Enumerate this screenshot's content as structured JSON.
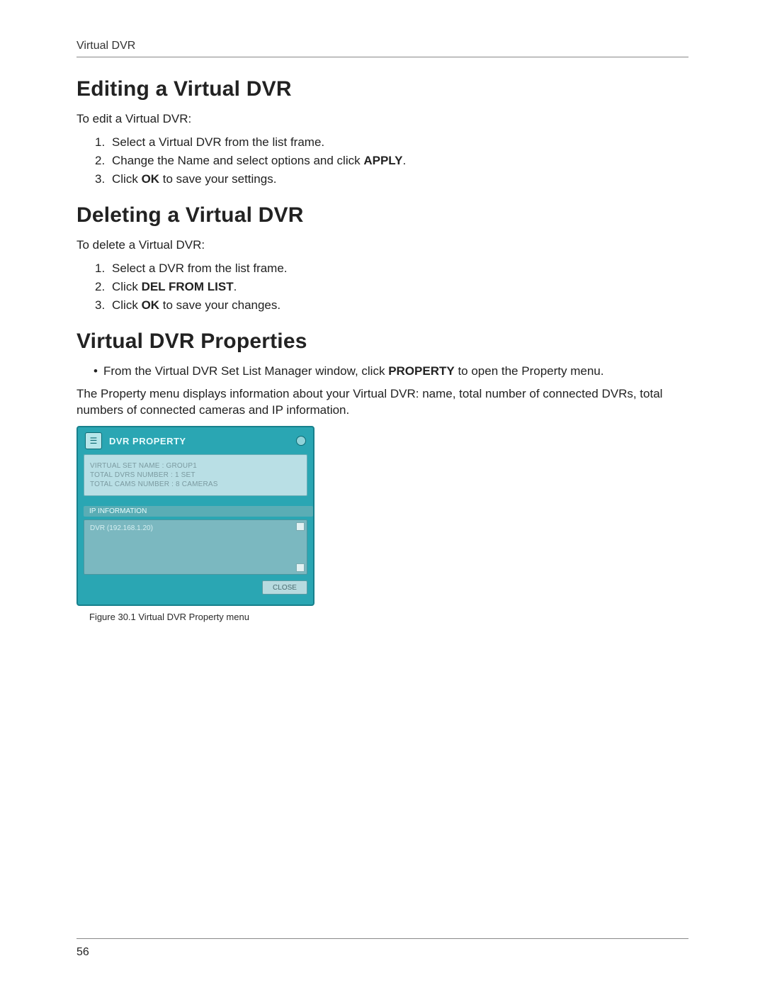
{
  "running_head": "Virtual DVR",
  "page_number": "56",
  "section1": {
    "heading": "Editing a Virtual DVR",
    "intro": "To edit a Virtual DVR:",
    "steps": {
      "s1": "Select a Virtual DVR from the list frame.",
      "s2_pre": "Change the Name and select options and click ",
      "s2_bold": "APPLY",
      "s2_post": ".",
      "s3_pre": "Click ",
      "s3_bold": "OK",
      "s3_post": " to save your settings."
    }
  },
  "section2": {
    "heading": "Deleting a Virtual DVR",
    "intro": "To delete a Virtual DVR:",
    "steps": {
      "s1": "Select a DVR from the list frame.",
      "s2_pre": "Click ",
      "s2_bold": "DEL FROM LIST",
      "s2_post": ".",
      "s3_pre": "Click ",
      "s3_bold": "OK",
      "s3_post": " to save your changes."
    }
  },
  "section3": {
    "heading": "Virtual DVR Properties",
    "bullet_pre": "From the Virtual DVR Set List Manager window, click ",
    "bullet_bold": "PROPERTY",
    "bullet_post": " to open the Property menu.",
    "para": "The Property menu displays information about your Virtual DVR: name, total number of connected DVRs, total numbers of connected cameras and IP information.",
    "figure_caption": "Figure 30.1 Virtual DVR Property menu"
  },
  "panel": {
    "title": "DVR PROPERTY",
    "rows": {
      "r1": "VIRTUAL SET NAME    :  GROUP1",
      "r2": "TOTAL DVRS NUMBER  :  1 SET",
      "r3": "TOTAL CAMS NUMBER  :  8 CAMERAS"
    },
    "ip_label": "IP INFORMATION",
    "ip_row": "DVR (192.168.1.20)",
    "close_label": "CLOSE"
  }
}
